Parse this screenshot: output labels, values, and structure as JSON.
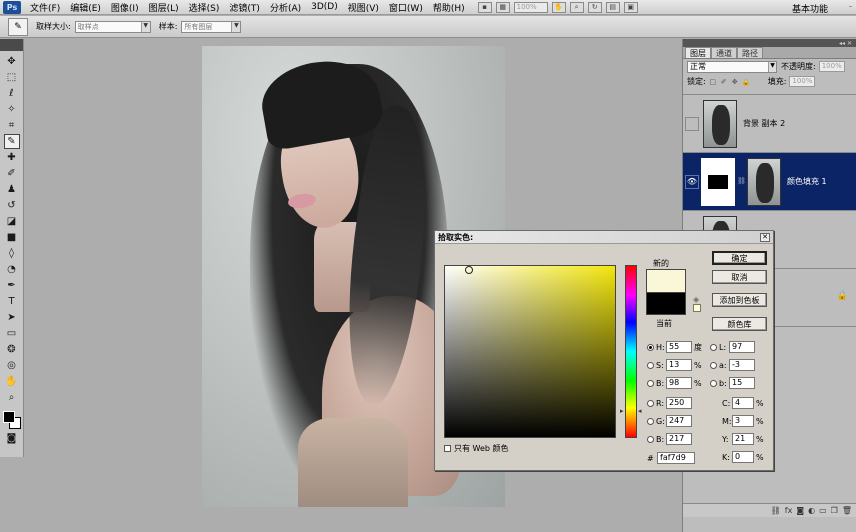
{
  "menubar": {
    "logo": "Ps",
    "items": [
      "文件(F)",
      "编辑(E)",
      "图像(I)",
      "图层(L)",
      "选择(S)",
      "滤镜(T)",
      "分析(A)",
      "3D(D)",
      "视图(V)",
      "窗口(W)",
      "帮助(H)"
    ],
    "zoom": "100%",
    "workspace": "基本功能"
  },
  "options": {
    "sample_size_label": "取样大小:",
    "sample_size_value": "取样点",
    "sample_label": "样本:",
    "sample_value": "所有图层"
  },
  "panel": {
    "tabs": [
      "图层",
      "通道",
      "路径"
    ],
    "blend_mode": "正常",
    "opacity_label": "不透明度:",
    "opacity_value": "100%",
    "lock_label": "锁定:",
    "fill_label": "填充:",
    "fill_value": "100%",
    "layers": [
      {
        "name": "背景 副本 2",
        "selected": false,
        "visible": false
      },
      {
        "name": "颜色填充 1",
        "selected": true,
        "visible": true
      },
      {
        "name": "",
        "selected": false,
        "visible": false
      },
      {
        "name": "",
        "selected": false,
        "visible": false,
        "locked": true
      }
    ]
  },
  "dialog": {
    "title": "拾取实色:",
    "new_label": "新的",
    "current_label": "当前",
    "new_color": "#faf7d9",
    "current_color": "#000000",
    "buttons": {
      "ok": "确定",
      "cancel": "取消",
      "add_swatch": "添加到色板",
      "libraries": "颜色库"
    },
    "hsb": {
      "h": "55",
      "h_unit": "度",
      "s": "13",
      "s_unit": "%",
      "b": "98",
      "b_unit": "%"
    },
    "rgb": {
      "r": "250",
      "g": "247",
      "b": "217"
    },
    "lab": {
      "l": "97",
      "a": "-3",
      "b": "15"
    },
    "cmyk": {
      "c": "4",
      "m": "3",
      "y": "21",
      "k": "0",
      "unit": "%"
    },
    "hex": "faf7d9",
    "web_only_label": "只有 Web 颜色"
  }
}
